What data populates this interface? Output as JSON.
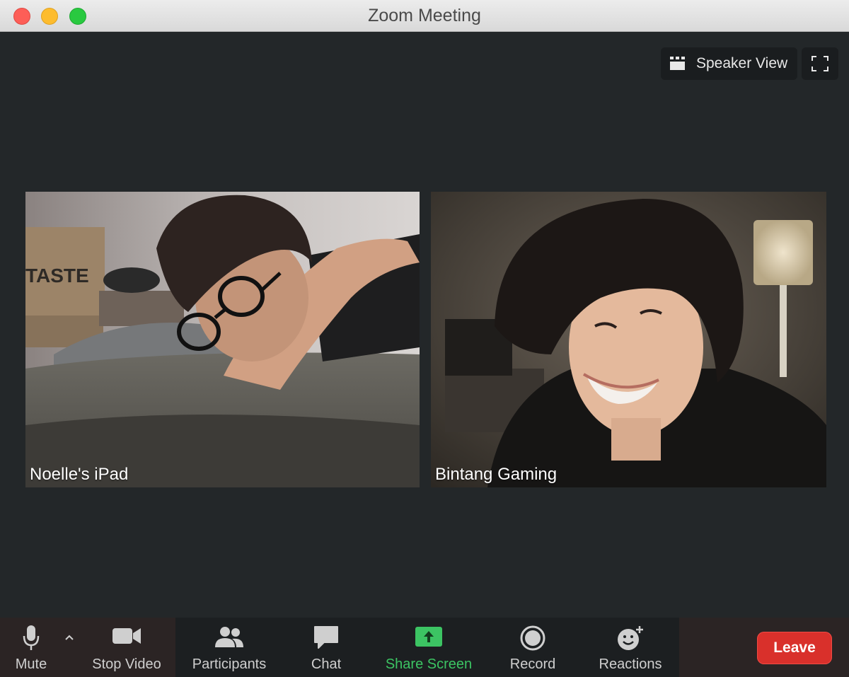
{
  "window": {
    "title": "Zoom Meeting"
  },
  "view_controls": {
    "speaker_view_label": "Speaker View"
  },
  "tiles": [
    {
      "name": "Noelle's iPad"
    },
    {
      "name": "Bintang Gaming"
    }
  ],
  "toolbar": {
    "mute_label": "Mute",
    "stop_video_label": "Stop Video",
    "participants_label": "Participants",
    "chat_label": "Chat",
    "share_screen_label": "Share Screen",
    "record_label": "Record",
    "reactions_label": "Reactions",
    "leave_label": "Leave"
  },
  "colors": {
    "share_accent": "#3cc463",
    "leave_red": "#d9302b",
    "background": "#232729"
  },
  "scene": {
    "box_print": "TASTE"
  }
}
